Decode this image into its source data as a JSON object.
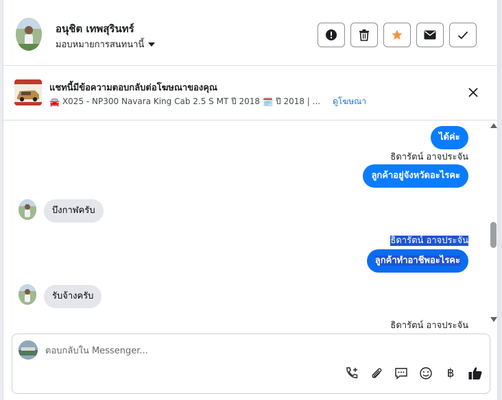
{
  "header": {
    "contact_name": "อนุชิต เทพสุรินทร์",
    "assign_label": "มอบหมายการสนทนานี้",
    "actions": [
      {
        "name": "report",
        "icon": "exclamation-icon"
      },
      {
        "name": "delete",
        "icon": "trash-icon"
      },
      {
        "name": "star",
        "icon": "star-icon"
      },
      {
        "name": "mark-unread",
        "icon": "envelope-icon"
      },
      {
        "name": "mark-done",
        "icon": "check-icon"
      }
    ]
  },
  "ad_context": {
    "title": "แชทนี้มีข้อความตอบกลับต่อโฆษณาของคุณ",
    "car_emoji": "🚘",
    "listing": "X025 - NP300 Navara King Cab 2.5 S MT ปี 2018",
    "calendar_emoji": "🗓️",
    "listing_tail": "ปี 2018 | ...",
    "view_ad_link": "ดูโฆษณา"
  },
  "messages": [
    {
      "direction": "out",
      "text": "ได้ค่ะ"
    },
    {
      "direction": "out",
      "sender": "ธิดารัตน์ อาจประจัน",
      "text": "ลูกค้าอยู่จังหวัดอะไรคะ"
    },
    {
      "direction": "in",
      "text": "บึงกาฬครับ"
    },
    {
      "direction": "out",
      "sender": "ธิดารัตน์ อาจประจัน",
      "text": "ลูกค้าทำอาชีพอะไรคะ",
      "selected": true
    },
    {
      "direction": "in",
      "text": "รับจ้างครับ"
    },
    {
      "direction": "out",
      "sender": "ธิดารัตน์ อาจประจัน"
    }
  ],
  "composer": {
    "placeholder": "ตอบกลับใน Messenger...",
    "tools": [
      "phone-plus-icon",
      "paperclip-icon",
      "saved-reply-icon",
      "emoji-icon",
      "baht-icon",
      "thumbs-up-icon"
    ],
    "baht_symbol": "฿"
  },
  "colors": {
    "accent": "#0a7cff",
    "star": "#f7923a",
    "selection": "#1e53d6",
    "incoming_bubble": "#e4e6eb"
  }
}
